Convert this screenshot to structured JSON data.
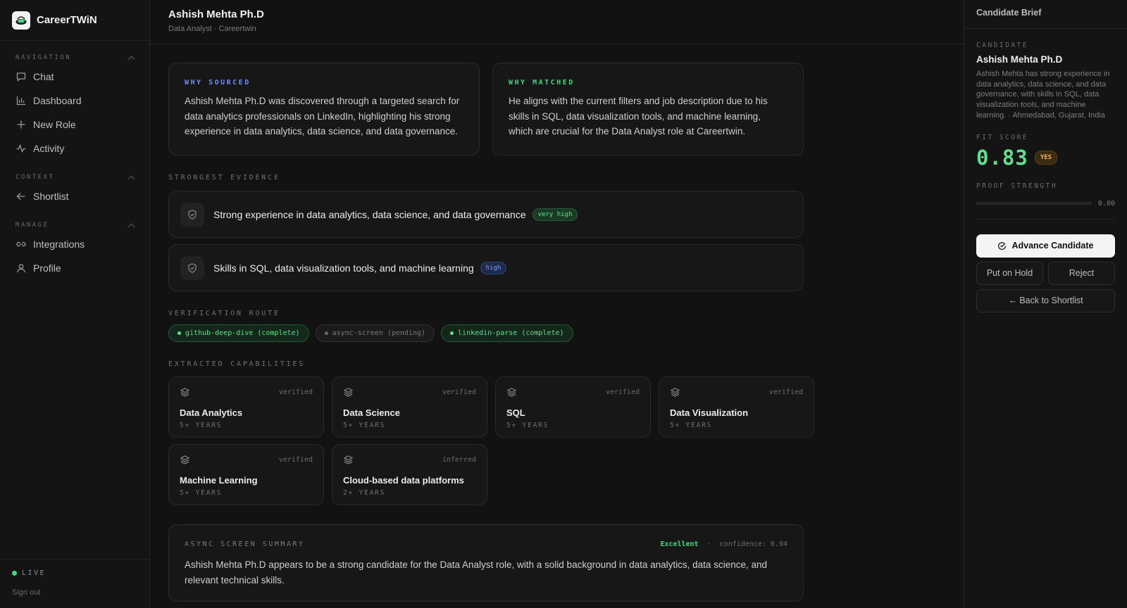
{
  "app": {
    "name": "CareerTWiN"
  },
  "sidebar": {
    "sections": [
      {
        "label": "NAVIGATION",
        "items": [
          "Chat",
          "Dashboard",
          "New Role",
          "Activity"
        ]
      },
      {
        "label": "CONTEXT",
        "items": [
          "Shortlist"
        ]
      },
      {
        "label": "MANAGE",
        "items": [
          "Integrations",
          "Profile"
        ]
      }
    ],
    "status": "LIVE",
    "sign_out": "Sign out"
  },
  "header": {
    "title": "Ashish Mehta Ph.D",
    "subtitle": "Data Analyst · Careertwin"
  },
  "why_sourced": {
    "label": "WHY SOURCED",
    "text": "Ashish Mehta Ph.D was discovered through a targeted search for data analytics professionals on LinkedIn, highlighting his strong experience in data analytics, data science, and data governance."
  },
  "why_matched": {
    "label": "WHY MATCHED",
    "text": "He aligns with the current filters and job description due to his skills in SQL, data visualization tools, and machine learning, which are crucial for the Data Analyst role at Careertwin."
  },
  "evidence": {
    "label": "STRONGEST EVIDENCE",
    "items": [
      {
        "text": "Strong experience in data analytics, data science, and data governance",
        "level": "very high"
      },
      {
        "text": "Skills in SQL, data visualization tools, and machine learning",
        "level": "high"
      }
    ]
  },
  "verification": {
    "label": "VERIFICATION ROUTE",
    "routes": [
      {
        "text": "github-deep-dive (complete)",
        "status": "complete"
      },
      {
        "text": "async-screen (pending)",
        "status": "pending"
      },
      {
        "text": "linkedin-parse (complete)",
        "status": "complete"
      }
    ]
  },
  "capabilities": {
    "label": "EXTRACTED CAPABILITIES",
    "items": [
      {
        "name": "Data Analytics",
        "years": "5+ YEARS",
        "status": "verified"
      },
      {
        "name": "Data Science",
        "years": "5+ YEARS",
        "status": "verified"
      },
      {
        "name": "SQL",
        "years": "5+ YEARS",
        "status": "verified"
      },
      {
        "name": "Data Visualization",
        "years": "5+ YEARS",
        "status": "verified"
      },
      {
        "name": "Machine Learning",
        "years": "5+ YEARS",
        "status": "verified"
      },
      {
        "name": "Cloud-based data platforms",
        "years": "2+ YEARS",
        "status": "inferred"
      }
    ]
  },
  "summary": {
    "label": "ASYNC SCREEN SUMMARY",
    "rating": "Excellent",
    "separator": "·",
    "confidence": "confidence: 0.94",
    "text": "Ashish Mehta Ph.D appears to be a strong candidate for the Data Analyst role, with a solid background in data analytics, data science, and relevant technical skills."
  },
  "brief": {
    "title": "Candidate Brief",
    "candidate_label": "CANDIDATE",
    "name": "Ashish Mehta Ph.D",
    "description": "Ashish Mehta has strong experience in data analytics, data science, and data governance, with skills in SQL, data visualization tools, and machine learning. · Ahmedabad, Gujarat, India",
    "fit_label": "FIT SCORE",
    "fit_score": "0.83",
    "fit_badge": "YES",
    "proof_label": "PROOF STRENGTH",
    "proof_value": "0.00",
    "proof_fraction": 0,
    "advance": "Advance Candidate",
    "hold": "Put on Hold",
    "reject": "Reject",
    "back": "← Back to Shortlist"
  },
  "colors": {
    "accent_green": "#5ee08f",
    "accent_blue": "#6f8ef5",
    "badge_amber": "#f1b34a"
  }
}
